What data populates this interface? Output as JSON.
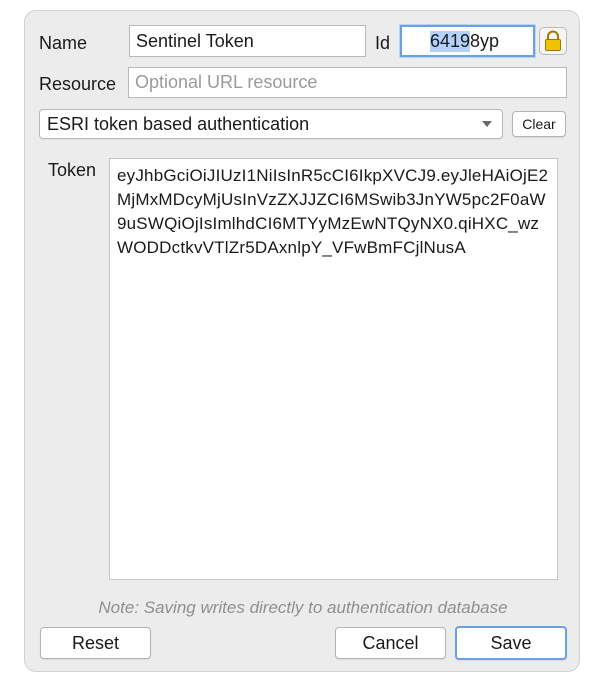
{
  "form": {
    "name_label": "Name",
    "name_value": "Sentinel Token",
    "id_label": "Id",
    "id_value_selected": "6419",
    "id_value_rest": "8yp",
    "resource_label": "Resource",
    "resource_placeholder": "Optional URL resource",
    "resource_value": "",
    "method_selected": "ESRI token based authentication",
    "clear_label": "Clear",
    "token_label": "Token",
    "token_value": "eyJhbGciOiJIUzI1NiIsInR5cCI6IkpXVCJ9.eyJleHAiOjE2MjMxMDcyMjUsInVzZXJJZCI6MSwib3JnYW5pc2F0aW9uSWQiOjIsImlhdCI6MTYyMzEwNTQyNX0.qiHXC_wzWODDctkvVTlZr5DAxnlpY_VFwBmFCjlNusA"
  },
  "footer": {
    "note": "Note: Saving writes directly to authentication database",
    "reset_label": "Reset",
    "cancel_label": "Cancel",
    "save_label": "Save"
  },
  "icons": {
    "lock": "lock-icon",
    "dropdown": "chevron-down-icon"
  },
  "colors": {
    "focus_border": "#6aa1e6",
    "selection": "#b3d2fb",
    "lock_fill": "#f2c200"
  }
}
